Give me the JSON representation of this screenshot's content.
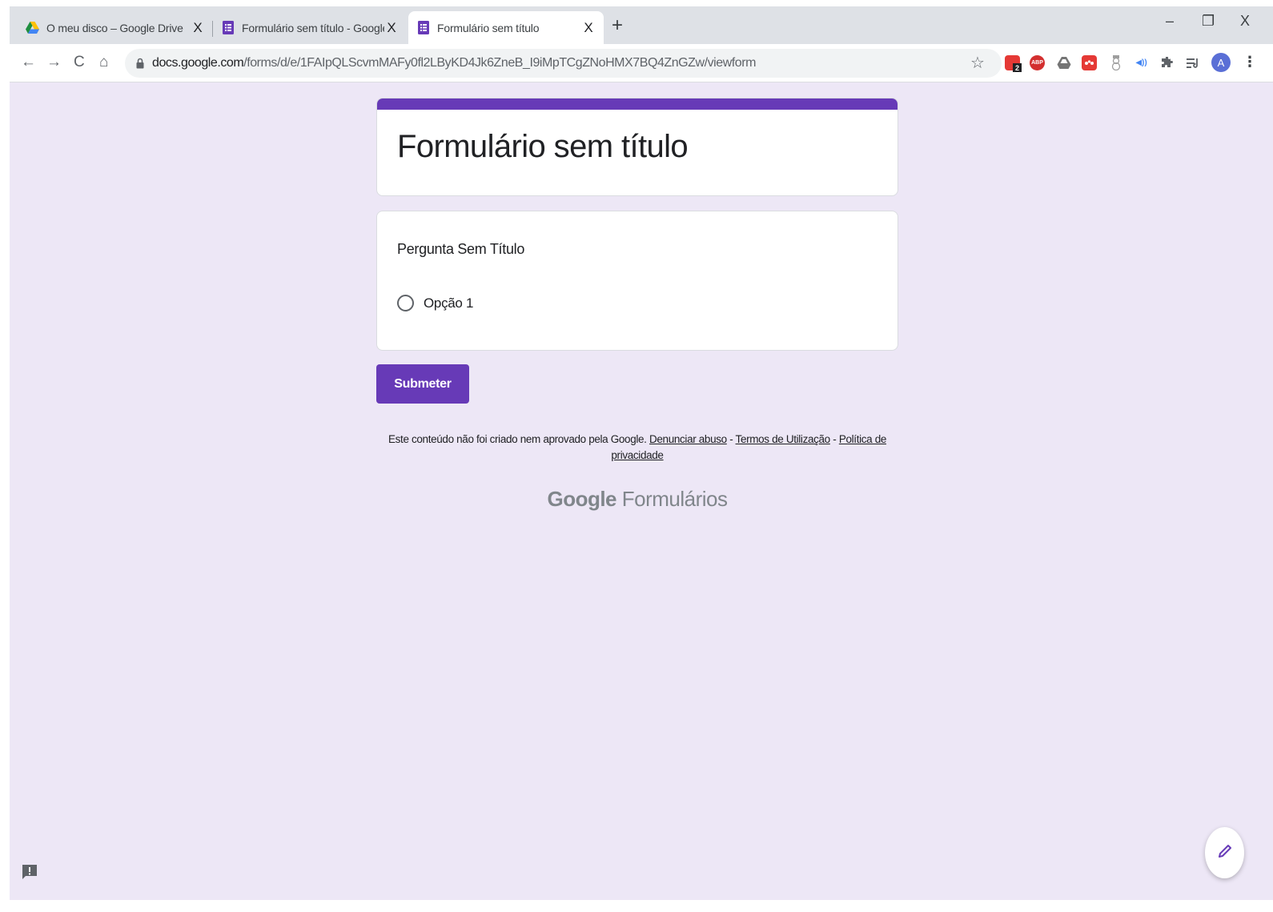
{
  "browser": {
    "tabs": [
      {
        "label": "O meu disco – Google Drive",
        "close": "X"
      },
      {
        "label": "Formulário sem título - Google Fo",
        "close": "X"
      },
      {
        "label": "Formulário sem título",
        "close": "X"
      }
    ],
    "new_tab": "+",
    "window": {
      "minimize": "–",
      "restore": "❐",
      "close": "X"
    },
    "nav": {
      "back": "←",
      "forward": "→",
      "reload": "C",
      "home": "⌂"
    },
    "url_host": "docs.google.com",
    "url_path": "/forms/d/e/1FAIpQLScvmMAFy0fl2LByKD4Jk6ZneB_I9iMpTCgZNoHMX7BQ4ZnGZw/viewform",
    "bookmark_star": "☆",
    "extensions": [
      {
        "name": "calendar-extension-icon",
        "color": "#e53935",
        "badge": "2"
      },
      {
        "name": "adblock-plus-icon",
        "color": "#d32f2f",
        "text": "ABP"
      },
      {
        "name": "drive-extension-icon",
        "color": "#757575"
      },
      {
        "name": "mendeley-icon",
        "color": "#e53935"
      },
      {
        "name": "snowman-extension-icon",
        "color": "#9e9e9e"
      },
      {
        "name": "audio-extension-icon",
        "color": "#4285f4"
      },
      {
        "name": "puzzle-extensions-icon",
        "color": "#5f6368"
      },
      {
        "name": "reading-list-icon",
        "color": "#5f6368"
      }
    ],
    "avatar_letter": "A",
    "menu": "⋮"
  },
  "form": {
    "accent_color": "#673ab7",
    "title": "Formulário sem título",
    "question": "Pergunta Sem Título",
    "option_1": "Opção 1",
    "submit_label": "Submeter",
    "disclaimer_text": "Este conteúdo não foi criado nem aprovado pela Google.",
    "link_report": "Denunciar abuso",
    "link_terms": "Termos de Utilização",
    "link_privacy": "Política de privacidade",
    "separator": "-",
    "brand_google": "Google",
    "brand_product": "Formulários"
  }
}
